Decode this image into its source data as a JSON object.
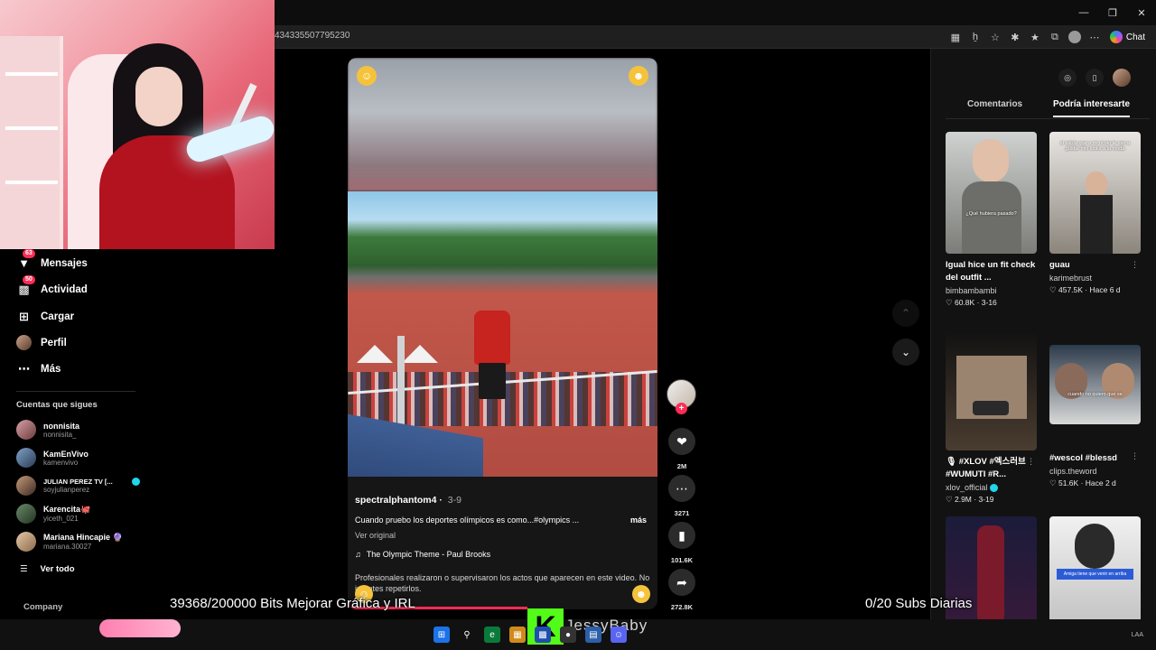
{
  "browser": {
    "url": "434335507795230",
    "chat_label": "Chat",
    "window_controls": [
      "minimize-icon",
      "restore-icon",
      "close-icon"
    ]
  },
  "sidebar": {
    "items": [
      {
        "label": "Mensajes",
        "badge": "63",
        "icon": "paper-plane-icon"
      },
      {
        "label": "Actividad",
        "badge": "50",
        "icon": "inbox-icon"
      },
      {
        "label": "Cargar",
        "icon": "plus-square-icon"
      },
      {
        "label": "Perfil",
        "icon": "avatar"
      },
      {
        "label": "Más",
        "icon": "ellipsis-icon"
      }
    ],
    "following_title": "Cuentas que sigues",
    "following": [
      {
        "name": "nonnisita",
        "handle": "nonnisita_"
      },
      {
        "name": "KamEnVivo",
        "handle": "kamenvivo"
      },
      {
        "name": "JULIAN PEREZ TV [...",
        "handle": "soyjulianperez",
        "verified": true
      },
      {
        "name": "Karencita🐙",
        "handle": "yiceth_021"
      },
      {
        "name": "Mariana Hincapie 🔮",
        "handle": "mariana.30027"
      }
    ],
    "see_all": "Ver todo",
    "company": "Company"
  },
  "video": {
    "username": "spectralphantom4",
    "date": "3-9",
    "caption": "Cuando pruebo los deportes olímpicos es como...#olympics ...",
    "more": "más",
    "original": "Ver original",
    "music": "The Olympic Theme - Paul Brooks",
    "warning": "Profesionales realizaron o supervisaron los actos que aparecen en este video. No intentes repetirlos.",
    "progress": 0.58
  },
  "actions": {
    "likes": "2M",
    "comments": "3271",
    "saves": "101.6K",
    "shares": "272.8K"
  },
  "right_panel": {
    "tabs": [
      "Comentarios",
      "Podría interesarte"
    ],
    "active_tab": 1,
    "cards": [
      {
        "title": "Igual hice un fit check del outfit ...",
        "author": "bimbambambi",
        "likes": "60.8K",
        "date": "3-16",
        "overlay": "¿Qué hubiera pasado?",
        "colors": [
          "#cfd2d0",
          "#7c7d79"
        ]
      },
      {
        "title": "guau",
        "author": "karimebrust",
        "likes": "457.5K",
        "date": "Hace 6 d",
        "overlay": "si sabía que a mi novio le van a gustar mis looks a la moda",
        "colors": [
          "#e9e6e2",
          "#8b857c"
        ]
      },
      {
        "title": "🎙 #XLOV #엑스러브 #WUMUTI #R...",
        "author": "xlov_official",
        "verified": true,
        "likes": "2.9M",
        "date": "3-19",
        "overlay": "",
        "colors": [
          "#111111",
          "#9a8470"
        ]
      },
      {
        "title": "#wescol #blessd",
        "author": "clips.theword",
        "likes": "51.6K",
        "date": "Hace 2 d",
        "overlay": "cuando no quiero que se",
        "colors": [
          "#2c3a4a",
          "#d9d9d9"
        ]
      },
      {
        "title": "",
        "author": "",
        "likes": "",
        "date": "",
        "overlay": "",
        "colors": [
          "#1b1b3a",
          "#7a1a2a"
        ]
      },
      {
        "title": "",
        "author": "",
        "likes": "",
        "date": "",
        "overlay": "Amiga tiene que venir en arriba",
        "colors": [
          "#f1f1f1",
          "#bdbdbd"
        ]
      }
    ]
  },
  "stream_overlay": {
    "bits_goal": "39368/200000 Bits Mejorar Gráfica y IRL",
    "subs_goal": "0/20 Subs Diarias",
    "streamer_name": "JessyBaby",
    "kick_logo": "K"
  },
  "colors": {
    "accent": "#fe2c55",
    "kick_green": "#53fc18",
    "verified": "#20d5ec"
  }
}
